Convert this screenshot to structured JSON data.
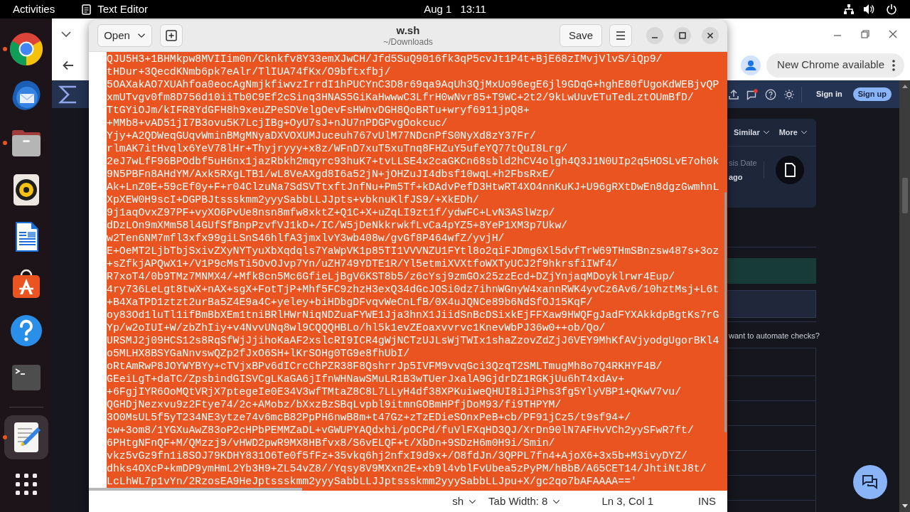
{
  "top_bar": {
    "activities": "Activities",
    "app": "Text Editor",
    "date": "Aug 1",
    "time": "13:11"
  },
  "dock": {
    "favorites": [
      {
        "kind": "browser",
        "running": true,
        "selected": false
      },
      {
        "kind": "mail",
        "running": false,
        "selected": false
      },
      {
        "kind": "files",
        "running": true,
        "selected": false
      },
      {
        "kind": "music",
        "running": false,
        "selected": false
      },
      {
        "kind": "writer",
        "running": false,
        "selected": false
      },
      {
        "kind": "store",
        "running": false,
        "selected": false
      },
      {
        "kind": "help",
        "running": false,
        "selected": false
      },
      {
        "kind": "terminal",
        "running": false,
        "selected": false
      }
    ],
    "open_apps": [
      {
        "kind": "editor",
        "running": true,
        "selected": true
      }
    ]
  },
  "browser": {
    "update_button": "New Chrome available",
    "site": {
      "sign_in": "Sign in",
      "sign_up": "Sign up",
      "filters": [
        "Similar",
        "More"
      ],
      "date_label": "sis Date",
      "date_value": "ago",
      "prompt": "want to automate checks?"
    }
  },
  "editor": {
    "open_button": "Open",
    "title": "w.sh",
    "subtitle": "~/Downloads",
    "save_button": "Save",
    "text_selected": true,
    "lines": [
      "QJU5H3+1BHMkpw8MVIIim0n/Cknkfv8Y33emXJwCH/Jfd5SuQ9016fk3qP5cvJt1P4t+BjE68zIMvjVlvS/iQp9/",
      "tHDur+3QecdKNmb6pk7eAlr/TlIUA74fKx/O9bftxfbj/",
      "5OAXakAO7XUAhfoa0eocAgNmjkfiwvzIrrdI1hPUCYnC3D8r69qa9AqUh3QjMxUo96egE6jl9GDqG+hghE80fUgoKdWEBjvQP",
      "xmUTvgv0fm8D756d10iiTb0C9Ef2cSinq3HNAS5GiKaHwwwC3LfrH0wNvr85+T9WC+2t2/9kLwUuvETuTedLztOUmBfD/",
      "TtGYiOJm/kIFR8YdGFH8h9xeuZPeSDVelgOevFsHWnvDGH8QoBRTu+wryf6911jpQ8+",
      "+MMb8+vAD51jI7B3ovu5K7LcjIBg+OyU7sJ+nJU7nPDGPvgOokcuc/",
      "Yjy+A2QDWeqGUqvWminBMgMNyaDXVOXUMJuceuh767vUlM77NDcnPfS0NyXd8zY37Fr/",
      "rlmAK7itHvqlx6YeV78lHr+Thyjryyy+x8z/WFnD7xuT5xuTnq8FHZuY5ufeYQ77tQuI8Lrg/",
      "2eJ7wLfF96BPOdbf5uH6nx1jazRbkh2mqyrc93huK7+tvLLSE4x2caGKCn68sbld2hCV4olgh4Q3J1N0UIp2q5HOSLvE7oh0k",
      "9N5PBFn8AHdYM/Axk5RXgLTB1/wL8VeAXgd8I6a52jN+jOHZuJI4dbsf10wqL+h2FbsRxE/",
      "Ak+LnZ0E+59cEf0y+F+r04ClzuNa7SdSVTtxftJnfNu+Pm5Tf+kDAdvPefD3HtwRT4XO4nnKuKJ+U96gRXtDwEn8dgzGwmhnL",
      "XpXEW0H9scI+DGPBJtssskmm2yyySabbLLJJpts+vbknuKlfJS9/+XkEDh/",
      "9j1aqOvxZ97PF+vyXO6PvUe8nsn8mfw8xktZ+Q1C+X+uZqLI9zt1f/ydwFC+LvN3ASlWzp/",
      "dDzLOn9mXMm58l4GUfSfBnpPzvfVJ1kD+/IC/W5jDeNkkrwkfLvCa4pYZ5+8YeP1XM3p7Ukw/",
      "w2Ten6NM7mfl3xfx99giLSnS46hlfA3jmxlvY3wb408w/gvGf8P464wfZ/yvjH/",
      "E+OeMT2LjbTbjSxivZXyNYTyuXbXqdqls7YaWpVK1p85TI1VVVNZU1FYtl8o2qiFJDmg6Xl5dvfTrW69THmSBnzsw487s+3oz",
      "+sZfkjAPQwX1+/V1P9cMsTi5OvOJvp7Yn/uZH749YDTE1R/Yl5etmiXVXtfoWXTyUCJ2f9hkrsfiIWf4/",
      "R7xoT4/0b9TMz7MNMX4/+Mfk8cn5Mc6GfieLjBgV6KST8b5/z6cYsj9zmGOx25zzEcd+DZjYnjaqMDoyklrwr4Eup/",
      "4ry736LeLgt8twX+nAX+sgX+FotTjP+Mhf5FC9zhzH3exQ34dGcJOSi0dz7ihnWGnyW4xannRWK4yvCz6Av6/10hztMsj+L6t",
      "+B4XaTPD1ztzt2urBa5Z4E9a4C+yeley+biHDbgDFvqvWeCnLfB/0X4uJQNCe89b6NdSfOJ15KqF/",
      "oy83Od1luTl1ifBmBbXEm1tniBRlHWrNiqNDZuaFYWE1Jja3hnX1JiidSnBcDSixkEjFFXaw9HWQFgJadFYXAkkdpBgtKs7rG",
      "Yp/w2oIUI+W/zbZhIiy+v4NvvUNq8wl9CQQQHBLo/hl5k1evZEoaxvvrvc1KnevWbPJ36w0++ob/Qo/",
      "URSMJ2j09HCS12s8RqSfWjJjihoKaAF2xslcRI9ICR4gWjNCTzUJLsWjTWIx1shaZzovZdZjJ6VEY9MhKfAVjyodgUgorBKl4",
      "o5MLHX8BSYGaNnvswQZp2fJxO6SH+lKrSOHg0TG9e8fhUbI/",
      "oRtAmRwP8JOYWYBYy+cTVjxBPv6dICrcChPZR38F8QshrrJp5IVFM9vvqGci3QzqT2SMLTmugMh8o7Q4RKHYF4B/",
      "GEeiLgT+daTC/ZpsbindGISVCgLKaGA6jIfnWHNawSMuLR1B3wTUerJxalA9GjdrDZ1RGKjUu6hT4xdAv+",
      "+6FgjIYR6OoMQtVRjX7ptegeIe0E34V3wfTMtaZ8C8L7LLyH4df38XPKuiweQHUI8iJiPhs3fg5YlyVBP1+QKwV7vu/",
      "QGHDjNezxvu9z2Ftye74/2c+AMobz/bXxzBzSBqLvpbl9itmnGOBmHPfjDoM93/fi9THPYM/",
      "3O0MsUL5f5yT234NE3ytze74v6mcB82PpPH6nwB8m+t47Gz+zTzEDieSOnxPeB+cb/PF91jCz5/t9sf94+/",
      "cw+3om8/1YGXuAwZ83oP2cHPbPEMMZaDL+vGWUPYAQdxhi/pOCPd/fuVlFXqHD3QJ/XrDn90lN7AFHvVCh2yySFwR7ft/",
      "6PHtgNFnQF+M/QMzzj9/vHWD2pwR9MX8HBfvx8/S6vELQF+t/XbDn+9SDzH6m0H9i/Smin/",
      "vkz5vGz9fn1i8SOJ79KDHY831O6Te0f5fFz+35vkq6hj2nfxI9d9x+/O8fdJn/3QPPL7fn4+AjoX6+3x5b+M3ivyDYZ/",
      "dhks4OXcP+kmDP9ymHmL2Yb3H9+ZL54vZ8//Yqsy8V9MXxn2E+xb9l4vblFvUbea5zPyPM/hBbB/A65CET14/JhtiNtJ8t/",
      "LcLhWL7p1vYn/2RzosEA9HeJptssskmm2yyySabbLLJJptssskmm2yyySabbLLJpu+X/gc2qo7bAFAAAA=='"
    ],
    "status": {
      "language": "sh",
      "tab_width": "Tab Width: 8",
      "position": "Ln 3, Col 1",
      "mode": "INS"
    }
  }
}
